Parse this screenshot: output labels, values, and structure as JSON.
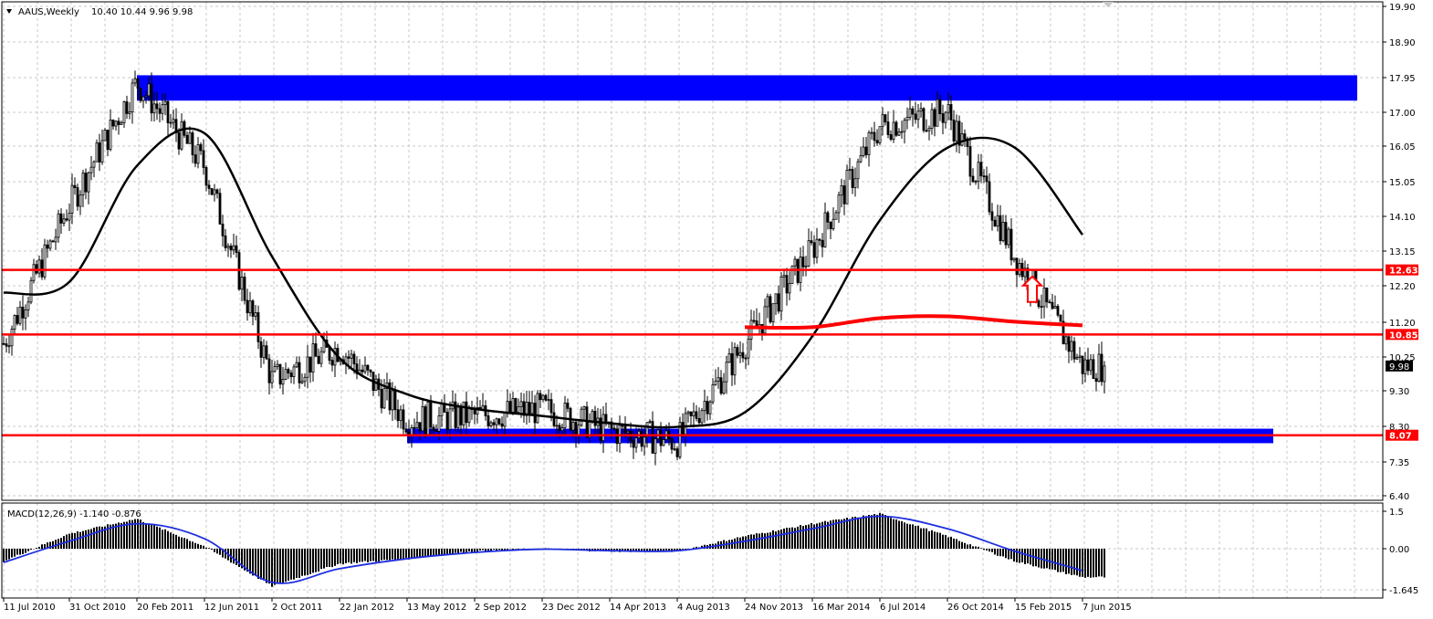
{
  "window": {
    "symbol_header": "AAUS,Weekly",
    "ohlc_header": "10.40 10.44 9.96 9.98",
    "indicator_header": "MACD(12,26,9) -1.140 -0.876"
  },
  "colors": {
    "grid": "#c8c8c8",
    "candle": "#000000",
    "zone": "#0000ff",
    "level": "#ff0000",
    "macd_signal": "#1f2fe0",
    "background": "#ffffff"
  },
  "chart_data": [
    {
      "type": "candlestick",
      "title": "AAUS,Weekly",
      "ylim": [
        6.4,
        19.9
      ],
      "y_ticks": [
        "19.90",
        "18.90",
        "17.95",
        "17.00",
        "16.05",
        "15.05",
        "14.10",
        "13.15",
        "12.20",
        "11.20",
        "10.25",
        "9.30",
        "8.30",
        "7.35",
        "6.40"
      ],
      "x_ticks": [
        "11 Jul 2010",
        "31 Oct 2010",
        "20 Feb 2011",
        "12 Jun 2011",
        "2 Oct 2011",
        "22 Jan 2012",
        "13 May 2012",
        "2 Sep 2012",
        "23 Dec 2012",
        "14 Apr 2013",
        "4 Aug 2013",
        "24 Nov 2013",
        "16 Mar 2014",
        "6 Jul 2014",
        "26 Oct 2014",
        "15 Feb 2015",
        "7 Jun 2015"
      ],
      "price_path": [
        [
          "11 Jul 2010",
          10.6
        ],
        [
          "31 Oct 2010",
          14.4
        ],
        [
          "20 Feb 2011",
          17.8
        ],
        [
          "12 Jun 2011",
          15.5
        ],
        [
          "2 Oct 2011",
          9.6
        ],
        [
          "22 Jan 2012",
          10.5
        ],
        [
          "13 May 2012",
          8.5
        ],
        [
          "2 Sep 2012",
          8.6
        ],
        [
          "23 Dec 2012",
          8.8
        ],
        [
          "14 Apr 2013",
          8.2
        ],
        [
          "4 Aug 2013",
          7.9
        ],
        [
          "24 Nov 2013",
          10.6
        ],
        [
          "16 Mar 2014",
          13.2
        ],
        [
          "6 Jul 2014",
          16.6
        ],
        [
          "26 Oct 2014",
          17.0
        ],
        [
          "15 Feb 2015",
          13.0
        ],
        [
          "7 Jun 2015",
          9.98
        ]
      ],
      "moving_average": [
        [
          "11 Jul 2010",
          12.0
        ],
        [
          "31 Oct 2010",
          12.3
        ],
        [
          "20 Feb 2011",
          15.5
        ],
        [
          "12 Jun 2011",
          16.4
        ],
        [
          "2 Oct 2011",
          13.0
        ],
        [
          "22 Jan 2012",
          10.2
        ],
        [
          "13 May 2012",
          9.2
        ],
        [
          "2 Sep 2012",
          8.8
        ],
        [
          "23 Dec 2012",
          8.6
        ],
        [
          "14 Apr 2013",
          8.4
        ],
        [
          "4 Aug 2013",
          8.3
        ],
        [
          "24 Nov 2013",
          8.7
        ],
        [
          "16 Mar 2014",
          10.8
        ],
        [
          "6 Jul 2014",
          14.0
        ],
        [
          "26 Oct 2014",
          16.0
        ],
        [
          "15 Feb 2015",
          16.0
        ],
        [
          "7 Jun 2015",
          13.6
        ]
      ],
      "long_average": [
        [
          "24 Nov 2013",
          11.05
        ],
        [
          "16 Mar 2014",
          11.05
        ],
        [
          "6 Jul 2014",
          11.3
        ],
        [
          "26 Oct 2014",
          11.35
        ],
        [
          "15 Feb 2015",
          11.2
        ],
        [
          "7 Jun 2015",
          11.1
        ]
      ],
      "resistance_zone": {
        "from": "20 Feb 2011",
        "to": "7 Jun 2015+",
        "low": 17.3,
        "high": 18.0
      },
      "support_zone": {
        "from": "13 May 2012",
        "to": "7 Jun 2015+",
        "low": 7.85,
        "high": 8.25
      },
      "horizontal_levels": [
        {
          "value": 12.63,
          "label": "12.63"
        },
        {
          "value": 10.85,
          "label": "10.85"
        },
        {
          "value": 8.07,
          "label": "8.07"
        }
      ],
      "last_price": {
        "value": 9.98,
        "label": "9.98"
      },
      "arrow_annotation": {
        "x": "15 Feb 2015",
        "y": 12.3,
        "direction": "up"
      }
    },
    {
      "type": "histogram",
      "title": "MACD(12,26,9) -1.140 -0.876",
      "ylim": [
        -1.645,
        1.5
      ],
      "y_ticks": [
        "1.5",
        "0.00",
        "-1.645"
      ],
      "histogram_path": [
        [
          "11 Jul 2010",
          -0.5
        ],
        [
          "31 Oct 2010",
          0.6
        ],
        [
          "20 Feb 2011",
          1.2
        ],
        [
          "12 Jun 2011",
          0.1
        ],
        [
          "2 Oct 2011",
          -1.5
        ],
        [
          "22 Jan 2012",
          -0.6
        ],
        [
          "13 May 2012",
          -0.4
        ],
        [
          "2 Sep 2012",
          -0.1
        ],
        [
          "23 Dec 2012",
          0.0
        ],
        [
          "14 Apr 2013",
          -0.1
        ],
        [
          "4 Aug 2013",
          -0.1
        ],
        [
          "24 Nov 2013",
          0.5
        ],
        [
          "16 Mar 2014",
          1.0
        ],
        [
          "6 Jul 2014",
          1.4
        ],
        [
          "26 Oct 2014",
          0.5
        ],
        [
          "15 Feb 2015",
          -0.5
        ],
        [
          "7 Jun 2015",
          -1.14
        ]
      ],
      "signal_path": [
        [
          "11 Jul 2010",
          -0.55
        ],
        [
          "31 Oct 2010",
          0.3
        ],
        [
          "20 Feb 2011",
          1.0
        ],
        [
          "12 Jun 2011",
          0.4
        ],
        [
          "2 Oct 2011",
          -1.35
        ],
        [
          "22 Jan 2012",
          -0.8
        ],
        [
          "13 May 2012",
          -0.4
        ],
        [
          "2 Sep 2012",
          -0.15
        ],
        [
          "23 Dec 2012",
          -0.02
        ],
        [
          "14 Apr 2013",
          -0.08
        ],
        [
          "4 Aug 2013",
          -0.08
        ],
        [
          "24 Nov 2013",
          0.3
        ],
        [
          "16 Mar 2014",
          0.8
        ],
        [
          "6 Jul 2014",
          1.3
        ],
        [
          "26 Oct 2014",
          0.8
        ],
        [
          "15 Feb 2015",
          -0.1
        ],
        [
          "7 Jun 2015",
          -0.876
        ]
      ]
    }
  ]
}
